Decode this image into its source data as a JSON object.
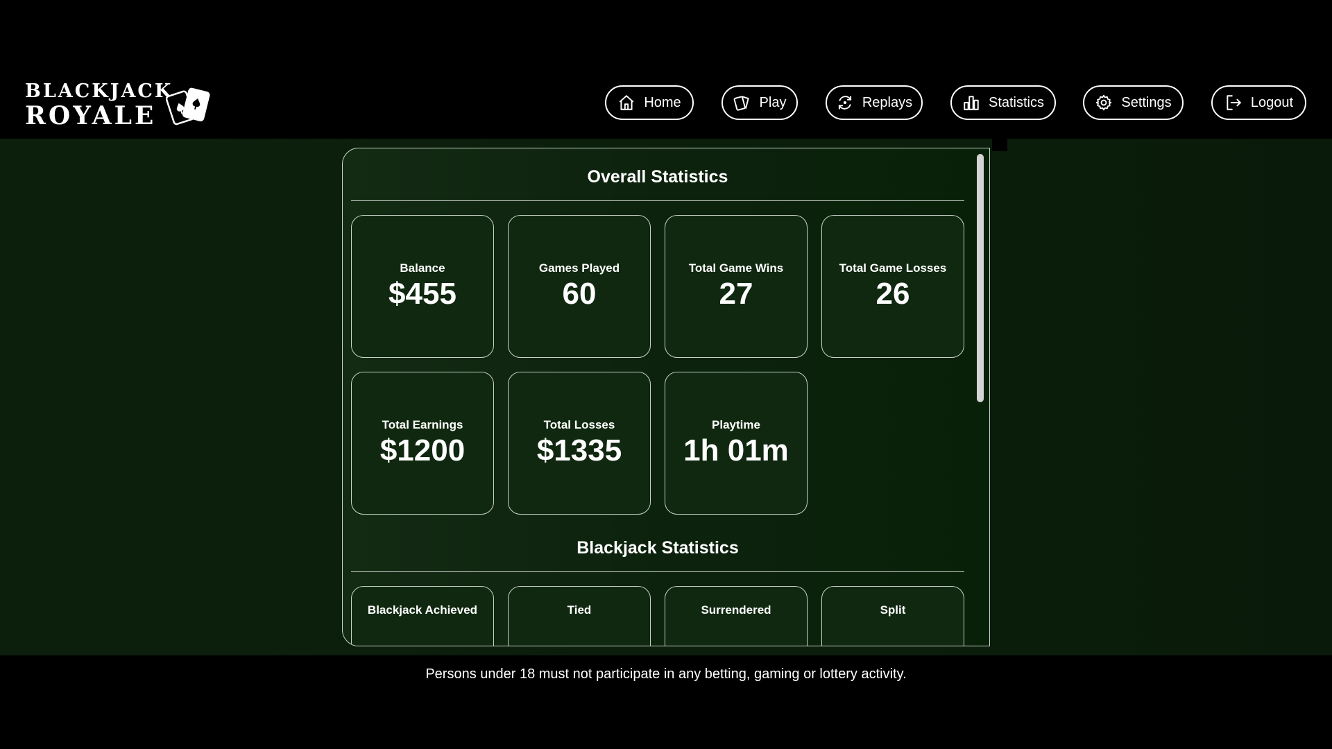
{
  "app": {
    "logo_line1": "BLACKJACK",
    "logo_line2": "ROYALE"
  },
  "nav": [
    {
      "label": "Home",
      "icon": "home-icon"
    },
    {
      "label": "Play",
      "icon": "cards-icon"
    },
    {
      "label": "Replays",
      "icon": "replay-icon"
    },
    {
      "label": "Statistics",
      "icon": "bar-chart-icon"
    },
    {
      "label": "Settings",
      "icon": "gear-icon"
    },
    {
      "label": "Logout",
      "icon": "logout-icon"
    }
  ],
  "overall": {
    "title": "Overall Statistics",
    "cards": [
      {
        "label": "Balance",
        "value": "$455"
      },
      {
        "label": "Games Played",
        "value": "60"
      },
      {
        "label": "Total Game Wins",
        "value": "27"
      },
      {
        "label": "Total Game Losses",
        "value": "26"
      },
      {
        "label": "Total Earnings",
        "value": "$1200"
      },
      {
        "label": "Total Losses",
        "value": "$1335"
      },
      {
        "label": "Playtime",
        "value": "1h 01m"
      }
    ]
  },
  "blackjack": {
    "title": "Blackjack Statistics",
    "cards": [
      {
        "label": "Blackjack Achieved"
      },
      {
        "label": "Tied"
      },
      {
        "label": "Surrendered"
      },
      {
        "label": "Split"
      }
    ]
  },
  "footer": {
    "notice": "Persons under 18 must not participate in any betting, gaming or lottery activity."
  },
  "colors": {
    "background": "#000000",
    "felt": "#0c1f0c",
    "card": "#102810",
    "border": "#c9d3c9"
  }
}
